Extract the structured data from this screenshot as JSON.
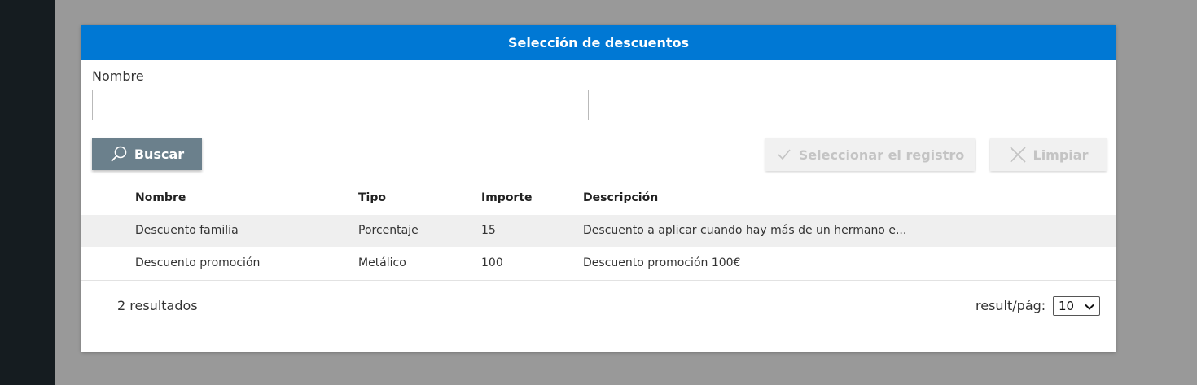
{
  "dialog": {
    "title": "Selección de descuentos",
    "field_label": "Nombre",
    "name_input": {
      "value": "",
      "placeholder": ""
    }
  },
  "toolbar": {
    "search_label": "Buscar",
    "select_label": "Seleccionar el registro",
    "clear_label": "Limpiar"
  },
  "table": {
    "columns": [
      "Nombre",
      "Tipo",
      "Importe",
      "Descripción"
    ],
    "rows": [
      [
        "Descuento familia",
        "Porcentaje",
        "15",
        "Descuento a aplicar cuando hay más de un hermano e..."
      ],
      [
        "Descuento promoción",
        "Metálico",
        "100",
        "Descuento promoción 100€"
      ]
    ]
  },
  "footer": {
    "results_text": "2 resultados",
    "page_size_label": "result/pág:",
    "page_size_value": "10"
  },
  "colors": {
    "header": "#0078d4",
    "search_button": "#6b808c",
    "disabled_button": "#f1f1f1",
    "selected_row": "#efefef"
  }
}
